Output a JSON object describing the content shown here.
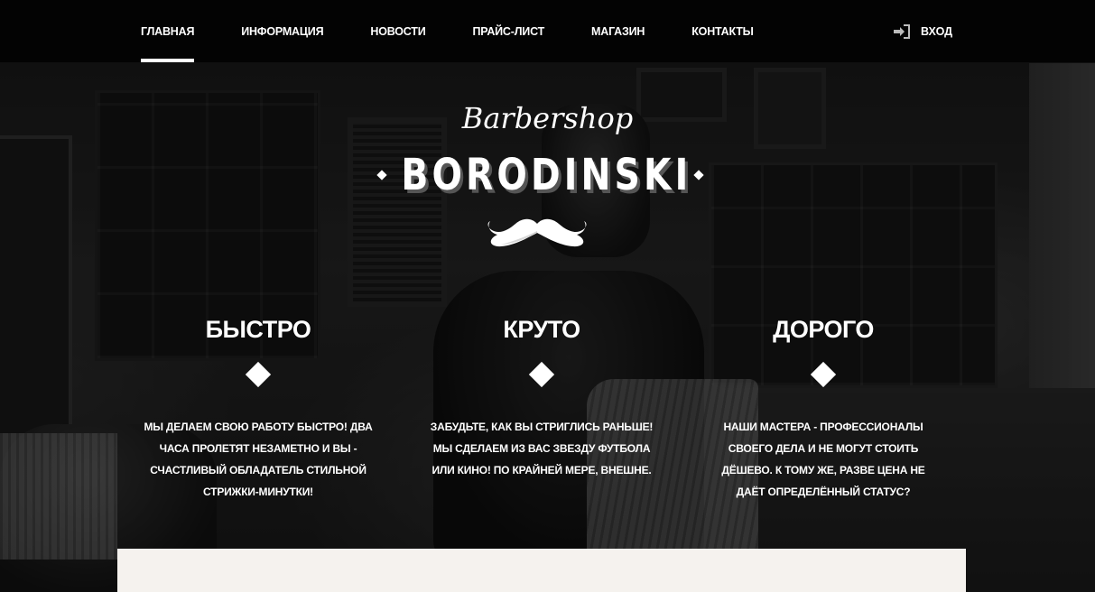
{
  "nav": {
    "items": [
      {
        "label": "ГЛАВНАЯ",
        "active": true
      },
      {
        "label": "ИНФОРМАЦИЯ",
        "active": false
      },
      {
        "label": "НОВОСТИ",
        "active": false
      },
      {
        "label": "ПРАЙС-ЛИСТ",
        "active": false
      },
      {
        "label": "МАГАЗИН",
        "active": false
      },
      {
        "label": "КОНТАКТЫ",
        "active": false
      }
    ],
    "login_label": "ВХОД",
    "login_icon": "sign-in-icon"
  },
  "logo": {
    "script": "Barbershop",
    "name": "BORODINSKI",
    "emblem_icon": "mustache-icon"
  },
  "features": [
    {
      "title": "БЫСТРО",
      "icon": "diamond-icon",
      "text": "МЫ ДЕЛАЕМ СВОЮ РАБОТУ БЫСТРО! ДВА ЧАСА ПРОЛЕТЯТ НЕЗАМЕТНО И ВЫ - СЧАСТЛИВЫЙ ОБЛАДАТЕЛЬ СТИЛЬНОЙ СТРИЖКИ-МИНУТКИ!"
    },
    {
      "title": "КРУТО",
      "icon": "diamond-icon",
      "text": "ЗАБУДЬТЕ, КАК ВЫ СТРИГЛИСЬ РАНЬШЕ! МЫ СДЕЛАЕМ ИЗ ВАС ЗВЕЗДУ ФУТБОЛА ИЛИ КИНО! ПО КРАЙНЕЙ МЕРЕ, ВНЕШНЕ."
    },
    {
      "title": "ДОРОГО",
      "icon": "diamond-icon",
      "text": "НАШИ МАСТЕРА - ПРОФЕССИОНАЛЫ СВОЕГО ДЕЛА И НЕ МОГУТ СТОИТЬ ДЁШЕВО. К ТОМУ ЖЕ, РАЗВЕ ЦЕНА НЕ ДАЁТ ОПРЕДЕЛЁННЫЙ СТАТУС?"
    }
  ],
  "colors": {
    "navbar_bg": "#030303",
    "text": "#ffffff",
    "panel_bg": "#f5f2ee"
  }
}
